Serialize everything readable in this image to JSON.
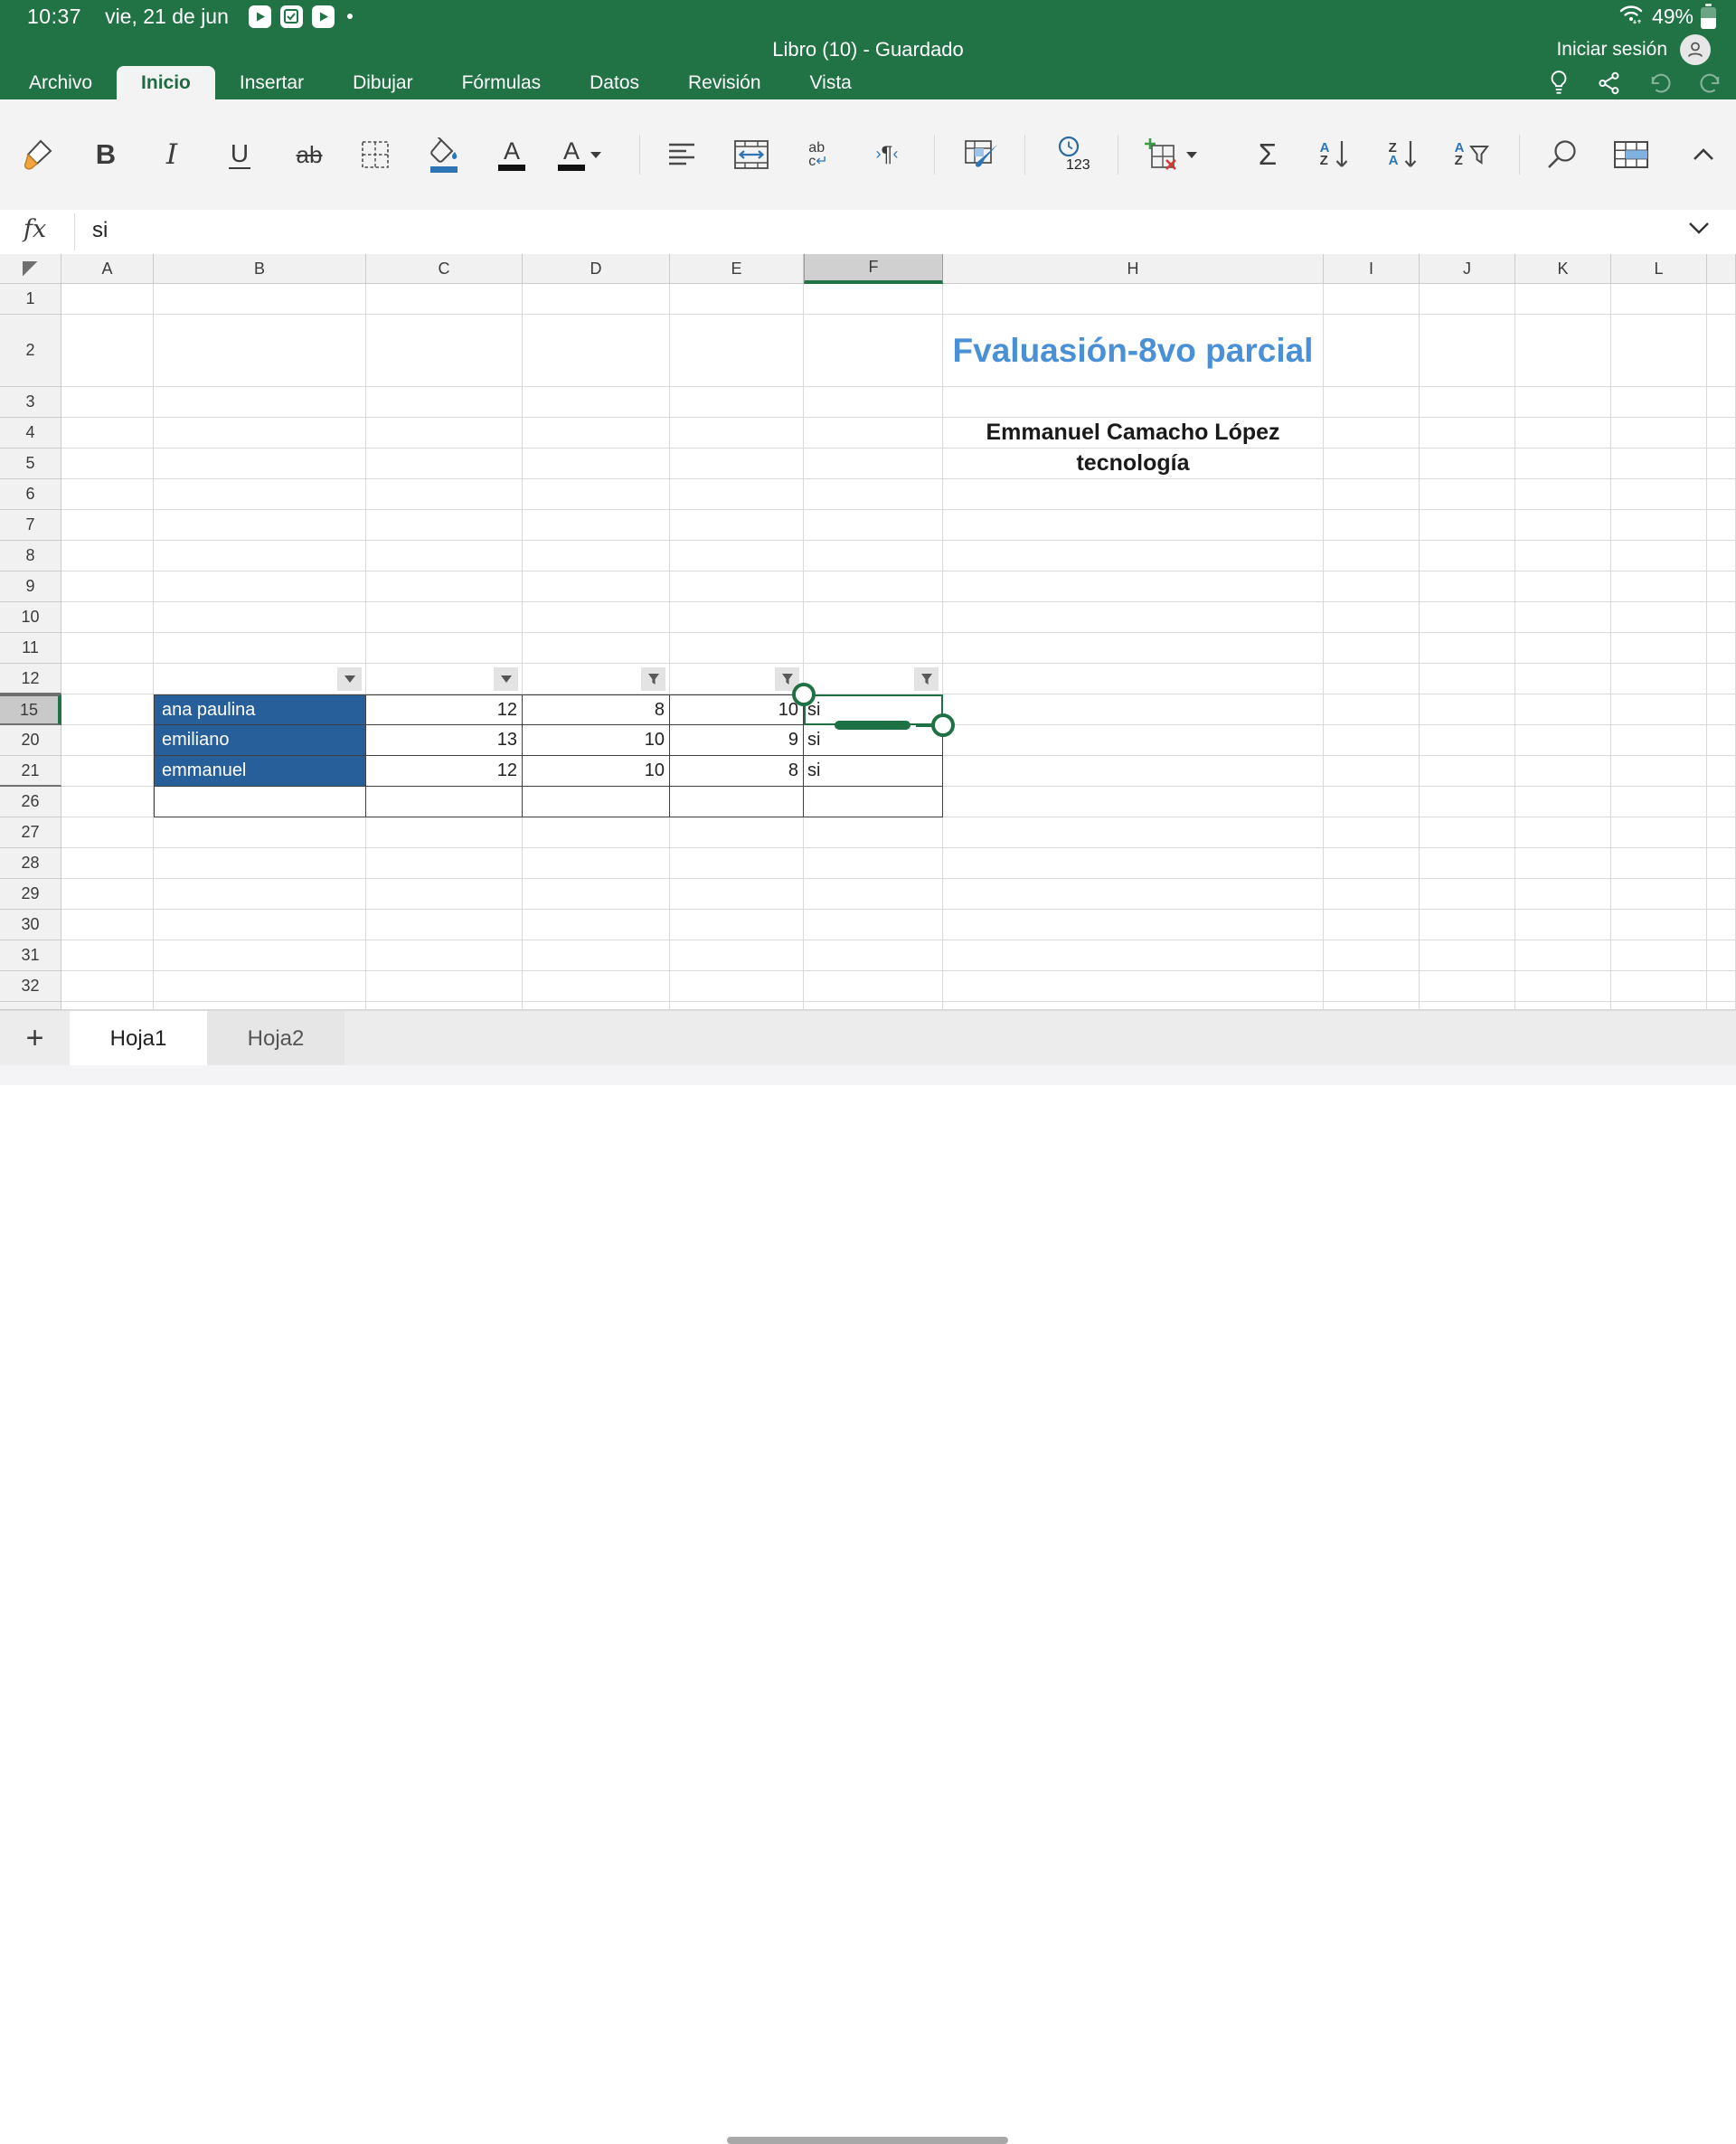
{
  "status_bar": {
    "time": "10:37",
    "date": "vie, 21 de jun",
    "battery_percent": "49%",
    "icons": [
      "play-app-icon",
      "checkbox-app-icon",
      "play-app-icon",
      "notification-dot",
      "wifi-icon",
      "battery-icon"
    ]
  },
  "title_bar": {
    "document_title": "Libro (10) - Guardado",
    "sign_in_label": "Iniciar sesión",
    "icons": [
      "avatar-person-icon"
    ]
  },
  "ribbon": {
    "tabs": [
      {
        "label": "Archivo",
        "active": false
      },
      {
        "label": "Inicio",
        "active": true
      },
      {
        "label": "Insertar",
        "active": false
      },
      {
        "label": "Dibujar",
        "active": false
      },
      {
        "label": "Fórmulas",
        "active": false
      },
      {
        "label": "Datos",
        "active": false
      },
      {
        "label": "Revisión",
        "active": false
      },
      {
        "label": "Vista",
        "active": false
      }
    ],
    "right_icons": [
      "ideas-lightbulb-icon",
      "share-icon",
      "undo-icon",
      "redo-icon"
    ]
  },
  "toolbar": {
    "icons": [
      "format-painter",
      "bold",
      "italic",
      "underline",
      "strikethrough",
      "borders",
      "fill-color",
      "font-color",
      "font-color-picker",
      "align",
      "merge-center",
      "wrap-text",
      "paragraph-marks",
      "cell-styles",
      "number-format",
      "insert-delete-cells",
      "autosum",
      "sort-ascending",
      "sort-descending",
      "filter",
      "find",
      "format-as-table",
      "collapse-ribbon"
    ],
    "wrap_text_lines": [
      "ab",
      "c"
    ],
    "number_format_digits": "123",
    "sort_letters": {
      "a": "A",
      "z": "Z"
    },
    "autosum_glyph": "Σ",
    "paragraph_glyph": "¶",
    "font_color_letter": "A",
    "accent_blue": "#2e75b6"
  },
  "formula_bar": {
    "fx_label": "fx",
    "value": "si"
  },
  "sheet": {
    "columns": [
      "A",
      "B",
      "C",
      "D",
      "E",
      "F",
      "H",
      "I",
      "J",
      "K",
      "L"
    ],
    "rows": [
      1,
      2,
      3,
      4,
      5,
      6,
      7,
      8,
      9,
      10,
      11,
      12,
      15,
      20,
      21,
      26,
      27,
      28,
      29,
      30,
      31,
      32
    ],
    "hidden_after_rows": [
      12,
      15,
      21
    ],
    "cells": [
      {
        "col": "H",
        "row": 2,
        "text": "Fvaluasión-8vo parcial",
        "class": "h-title"
      },
      {
        "col": "H",
        "row": 4,
        "text": "Emmanuel Camacho López",
        "class": "h-author"
      },
      {
        "col": "H",
        "row": 5,
        "text": "tecnología",
        "class": "h-subject"
      }
    ],
    "filter_row": 12,
    "filters": [
      {
        "col": "B",
        "icon": "dropdown"
      },
      {
        "col": "C",
        "icon": "dropdown"
      },
      {
        "col": "D",
        "icon": "funnel"
      },
      {
        "col": "E",
        "icon": "funnel"
      },
      {
        "col": "F",
        "icon": "funnel"
      }
    ],
    "table": {
      "rows": [
        {
          "row": 15,
          "values": {
            "B": "ana paulina",
            "C": "12",
            "D": "8",
            "E": "10",
            "F": "si"
          }
        },
        {
          "row": 20,
          "values": {
            "B": "emiliano",
            "C": "13",
            "D": "10",
            "E": "9",
            "F": "si"
          }
        },
        {
          "row": 21,
          "values": {
            "B": "emmanuel",
            "C": "12",
            "D": "10",
            "E": "8",
            "F": "si"
          }
        }
      ],
      "empty_row": 26
    },
    "selection": {
      "cell": "F15",
      "active_col": "F",
      "active_row": 15
    }
  },
  "sheet_tabs": {
    "add_label": "+",
    "tabs": [
      {
        "label": "Hoja1",
        "active": true
      },
      {
        "label": "Hoja2",
        "active": false
      }
    ]
  },
  "colors": {
    "excel_green": "#217346",
    "selection_green": "#1e7145",
    "title_blue": "#4a90d6",
    "name_fill_blue": "#275f9b"
  }
}
